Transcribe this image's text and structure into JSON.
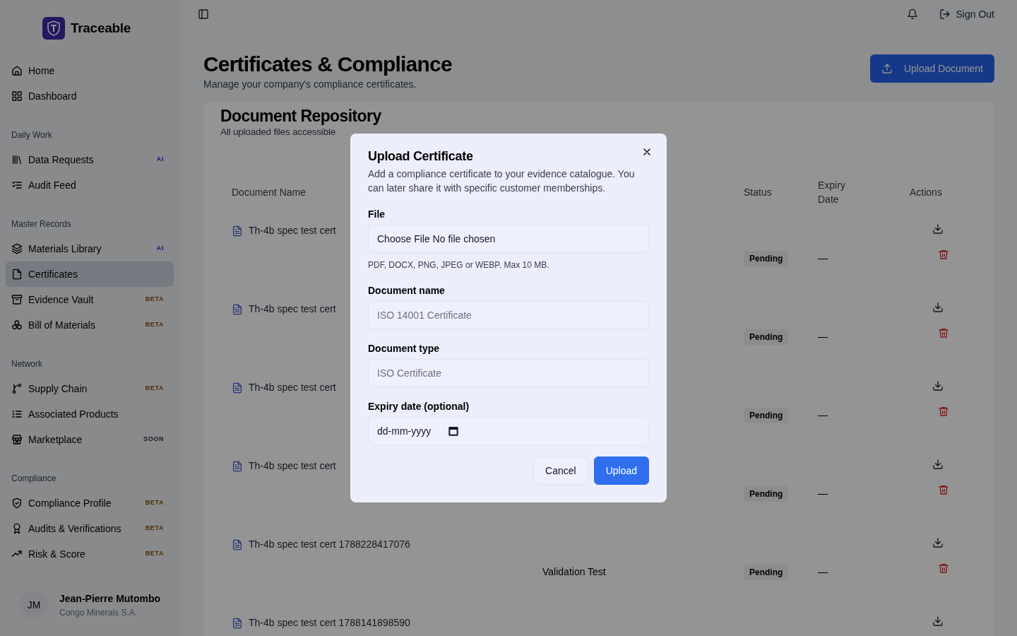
{
  "sidebar": {
    "brand": "Traceable",
    "groups": [
      {
        "items": [
          {
            "label": "Home",
            "selected": false
          },
          {
            "label": "Dashboard",
            "selected": false
          }
        ]
      },
      {
        "label": "Daily Work",
        "items": [
          {
            "label": "Data Requests",
            "selected": false,
            "badge": {
              "text": "AI",
              "kind": "ai"
            }
          },
          {
            "label": "Audit Feed",
            "selected": false
          }
        ]
      },
      {
        "label": "Master Records",
        "items": [
          {
            "label": "Materials Library",
            "selected": false,
            "badge": {
              "text": "AI",
              "kind": "ai"
            }
          },
          {
            "label": "Certificates",
            "selected": true
          },
          {
            "label": "Evidence Vault",
            "selected": false,
            "badge": {
              "text": "BETA",
              "kind": "beta"
            }
          },
          {
            "label": "Bill of Materials",
            "selected": false,
            "badge": {
              "text": "BETA",
              "kind": "beta"
            }
          }
        ]
      },
      {
        "label": "Network",
        "items": [
          {
            "label": "Supply Chain",
            "selected": false,
            "badge": {
              "text": "BETA",
              "kind": "beta"
            }
          },
          {
            "label": "Associated Products",
            "selected": false
          },
          {
            "label": "Marketplace",
            "selected": false,
            "badge": {
              "text": "SOON",
              "kind": "soon"
            }
          }
        ]
      },
      {
        "label": "Compliance",
        "items": [
          {
            "label": "Compliance Profile",
            "selected": false,
            "badge": {
              "text": "BETA",
              "kind": "beta"
            }
          },
          {
            "label": "Audits & Verifications",
            "selected": false,
            "badge": {
              "text": "BETA",
              "kind": "beta"
            }
          },
          {
            "label": "Risk & Score",
            "selected": false,
            "badge": {
              "text": "BETA",
              "kind": "beta"
            }
          }
        ]
      }
    ],
    "user": {
      "initials": "JM",
      "name": "Jean-Pierre Mutombo",
      "company": "Congo Minerals S.A."
    }
  },
  "topbar": {
    "sign_out": "Sign Out"
  },
  "page": {
    "title": "Certificates & Compliance",
    "subtitle": "Manage your company's compliance certificates.",
    "upload_button": "Upload Document"
  },
  "repository": {
    "title": "Document Repository",
    "subtitle": "All uploaded files accessible",
    "columns": [
      "Document Name",
      null,
      "Status",
      "Expiry Date",
      "Actions"
    ],
    "rows": [
      {
        "name": "Th-4b spec test cert",
        "status": "Pending",
        "expiry": "—"
      },
      {
        "name": "Th-4b spec test cert",
        "status": "Pending",
        "expiry": "—"
      },
      {
        "name": "Th-4b spec test cert",
        "status": "Pending",
        "expiry": "—"
      },
      {
        "name": "Th-4b spec test cert",
        "status": "Pending",
        "expiry": "—"
      },
      {
        "name": "Th-4b spec test cert 1788228417076",
        "type": "Validation Test",
        "status": "Pending",
        "expiry": "—"
      },
      {
        "name": "Th-4b spec test cert 1788141898590"
      }
    ]
  },
  "dialog": {
    "title": "Upload Certificate",
    "description": "Add a compliance certificate to your evidence catalogue. You can later share it with specific customer memberships.",
    "fields": [
      {
        "kind": "file",
        "label": "File",
        "value": "Choose File No file chosen",
        "hint": "PDF, DOCX, PNG, JPEG or WEBP. Max 10 MB."
      },
      {
        "kind": "text",
        "label": "Document name",
        "placeholder": "ISO 14001 Certificate"
      },
      {
        "kind": "text",
        "label": "Document type",
        "placeholder": "ISO Certificate"
      },
      {
        "kind": "date",
        "label": "Expiry date (optional)",
        "value": "dd-mm-yyyy"
      }
    ],
    "buttons": [
      {
        "label": "Cancel",
        "kind": "secondary"
      },
      {
        "label": "Upload",
        "kind": "primary"
      }
    ]
  }
}
